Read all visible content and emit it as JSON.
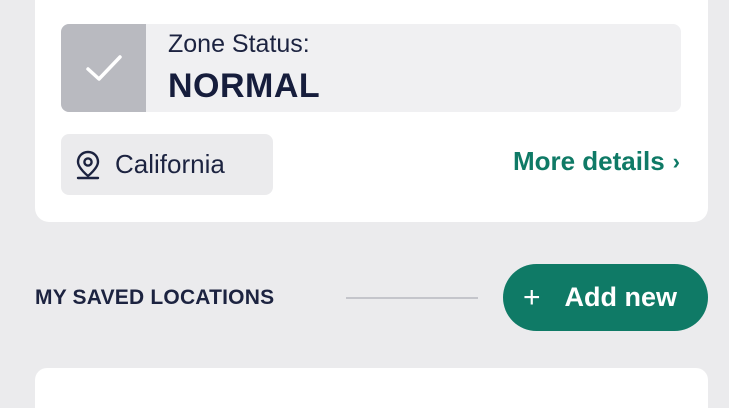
{
  "zone": {
    "label": "Zone Status:",
    "value": "NORMAL",
    "status_icon": "check-icon"
  },
  "location": {
    "icon": "map-pin-icon",
    "name": "California"
  },
  "more_details": {
    "label": "More details",
    "chevron": "›"
  },
  "saved_locations": {
    "title": "MY SAVED LOCATIONS",
    "add_button_icon": "+",
    "add_button_label": "Add new"
  },
  "colors": {
    "accent": "#0f7a66",
    "text": "#1c2340",
    "background": "#ebebed",
    "status_tile": "#b9bac0"
  }
}
